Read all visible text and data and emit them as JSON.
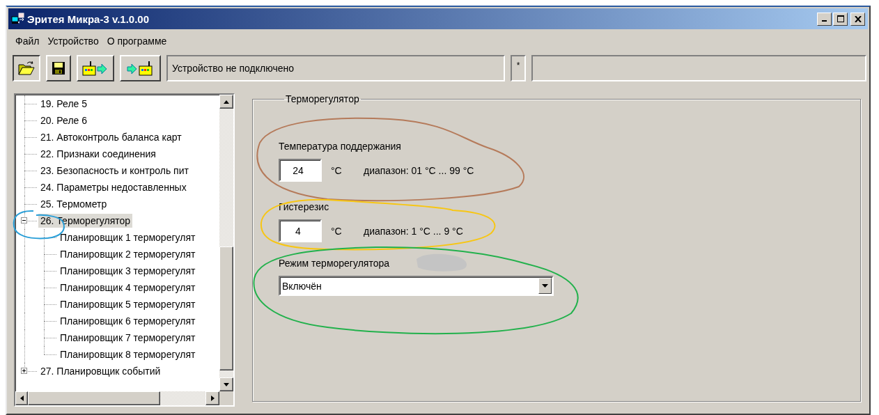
{
  "window": {
    "title": "Эритея Микра-3 v.1.0.00"
  },
  "menu": [
    "Файл",
    "Устройство",
    "О программе"
  ],
  "toolbar": {
    "buttons": [
      {
        "kind": "open"
      },
      {
        "kind": "save"
      },
      {
        "kind": "upload"
      },
      {
        "kind": "download"
      }
    ],
    "status_fields": [
      {
        "value": "Устройство не подключено"
      },
      {
        "value": "*"
      }
    ]
  },
  "tree": {
    "items": [
      {
        "label": "19. Реле 5",
        "selected": false
      },
      {
        "label": "20. Реле 6",
        "selected": false
      },
      {
        "label": "21. Автоконтроль баланса карт",
        "selected": false
      },
      {
        "label": "22. Признаки соединения",
        "selected": false
      },
      {
        "label": "23. Безопасность и контроль пит",
        "selected": false
      },
      {
        "label": "24. Параметры недоставленных",
        "selected": false
      },
      {
        "label": "25. Термометр",
        "selected": false
      },
      {
        "label": "26. Терморегулятор",
        "selected": true,
        "expanded": true,
        "children": [
          {
            "label": "Планировщик 1 терморегулят",
            "selected": false
          },
          {
            "label": "Планировщик 2 терморегулят",
            "selected": false
          },
          {
            "label": "Планировщик 3 терморегулят",
            "selected": false
          },
          {
            "label": "Планировщик 4 терморегулят",
            "selected": false
          },
          {
            "label": "Планировщик 5 терморегулят",
            "selected": false
          },
          {
            "label": "Планировщик 6 терморегулят",
            "selected": false
          },
          {
            "label": "Планировщик 7 терморегулят",
            "selected": false
          },
          {
            "label": "Планировщик 8 терморегулят",
            "selected": false
          }
        ]
      },
      {
        "label": "27. Планировщик событий",
        "selected": false,
        "expanded": false
      }
    ]
  },
  "panel": {
    "title": "Терморегулятор",
    "fields": [
      {
        "label": "Температура поддержания",
        "value": "24",
        "unit": "°C",
        "range": "диапазон: 01 °C ... 99 °C"
      },
      {
        "label": "Гистерезис",
        "value": "4",
        "unit": "°C",
        "range": "диапазон: 1 °C ... 9 °C"
      }
    ],
    "mode": {
      "label": "Режим терморегулятора",
      "value": "Включён"
    }
  },
  "annotations": [
    {
      "kind": "ellipse",
      "color": "#b57a5a"
    },
    {
      "kind": "ellipse",
      "color": "#f7c614"
    },
    {
      "kind": "ellipse",
      "color": "#22b14c"
    },
    {
      "kind": "ellipse",
      "color": "#2a9fd8"
    },
    {
      "kind": "smudge"
    }
  ]
}
